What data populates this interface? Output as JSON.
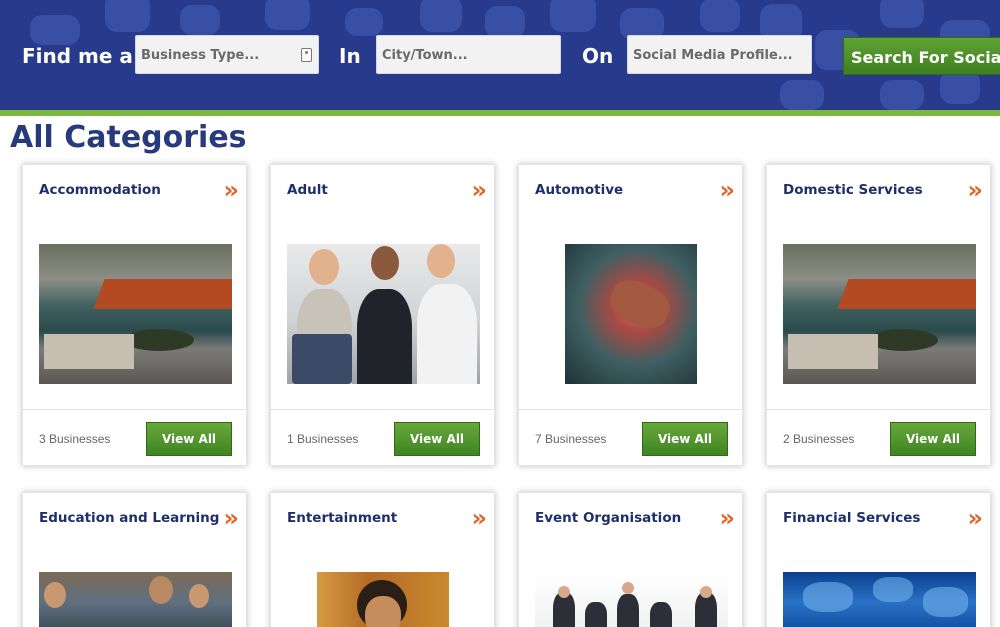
{
  "header": {
    "find_label": "Find me a",
    "in_label": "In",
    "on_label": "On",
    "business_type_placeholder": "Business Type...",
    "city_placeholder": "City/Town...",
    "social_placeholder": "Social Media Profile...",
    "search_button": "Search For Social™"
  },
  "page_title": "All Categories",
  "colors": {
    "header_bg": "#283a8c",
    "accent_green": "#7cb83e",
    "title_blue": "#273a7e",
    "chevron_orange": "#e0662a"
  },
  "view_all_label": "View All",
  "chevron_glyph": "»",
  "categories": [
    {
      "title": "Accommodation",
      "count": "3 Businesses",
      "image": "pool-resort-image"
    },
    {
      "title": "Adult",
      "count": "1 Businesses",
      "image": "business-meeting-image"
    },
    {
      "title": "Automotive",
      "count": "7 Businesses",
      "image": "spark-plug-image"
    },
    {
      "title": "Domestic Services",
      "count": "2 Businesses",
      "image": "pool-resort-image"
    },
    {
      "title": "Education and Learning",
      "image": "classroom-image"
    },
    {
      "title": "Entertainment",
      "image": "performer-image"
    },
    {
      "title": "Event Organisation",
      "image": "business-people-image"
    },
    {
      "title": "Financial Services",
      "image": "world-map-image"
    }
  ]
}
